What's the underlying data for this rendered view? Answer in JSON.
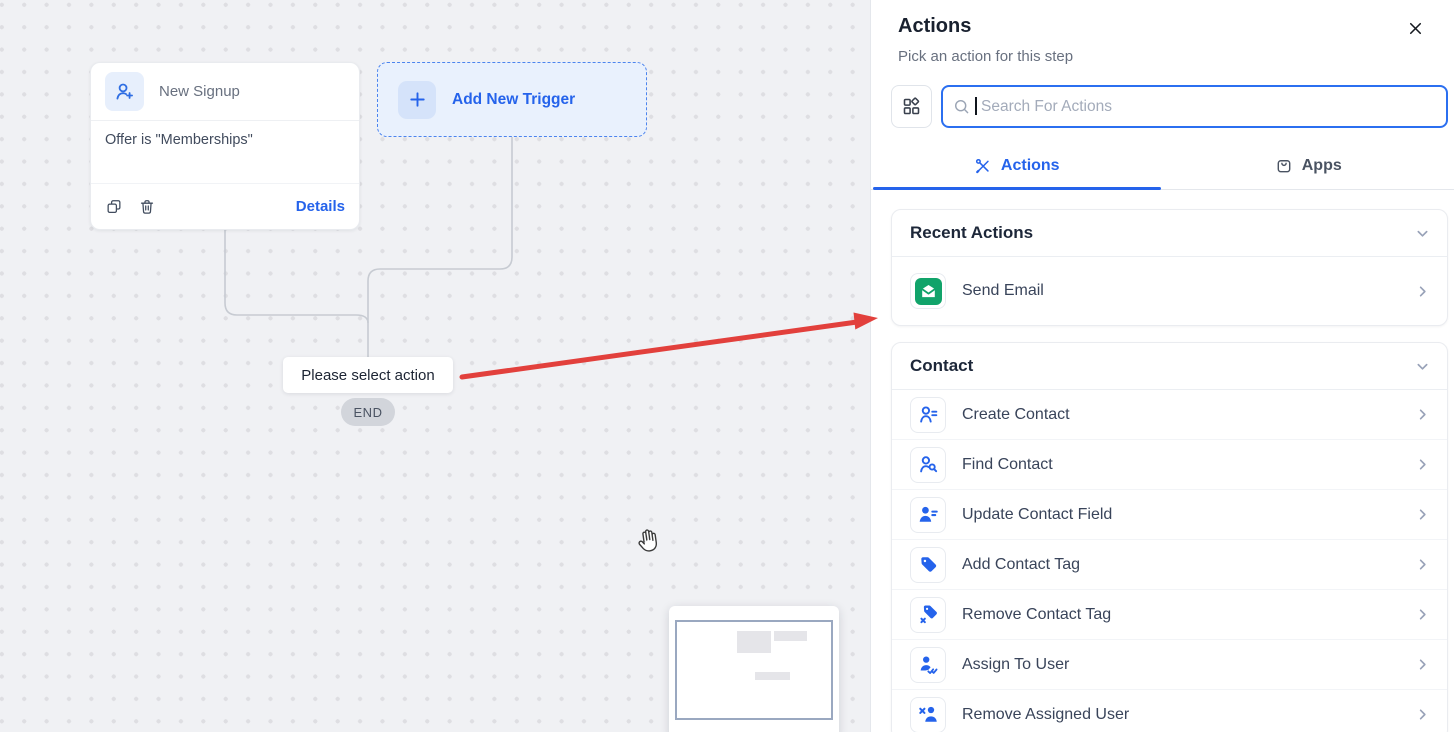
{
  "canvas": {
    "trigger_card": {
      "title": "New Signup",
      "filter": "Offer is \"Memberships\"",
      "details_label": "Details"
    },
    "add_trigger_label": "Add New Trigger",
    "select_action_label": "Please select action",
    "end_label": "END"
  },
  "panel": {
    "title": "Actions",
    "subtitle": "Pick an action for this step",
    "search": {
      "placeholder": "Search For Actions",
      "value": ""
    },
    "tabs": [
      {
        "label": "Actions",
        "icon": "tools-icon",
        "active": true
      },
      {
        "label": "Apps",
        "icon": "apps-bag-icon",
        "active": false
      }
    ],
    "sections": [
      {
        "title": "Recent Actions",
        "items": [
          {
            "label": "Send Email",
            "icon": "send-email"
          }
        ]
      },
      {
        "title": "Contact",
        "items": [
          {
            "label": "Create Contact",
            "icon": "create-contact"
          },
          {
            "label": "Find Contact",
            "icon": "find-contact"
          },
          {
            "label": "Update Contact Field",
            "icon": "update-contact-field"
          },
          {
            "label": "Add Contact Tag",
            "icon": "add-contact-tag"
          },
          {
            "label": "Remove Contact Tag",
            "icon": "remove-contact-tag"
          },
          {
            "label": "Assign To User",
            "icon": "assign-to-user"
          },
          {
            "label": "Remove Assigned User",
            "icon": "remove-assigned-user"
          }
        ]
      }
    ]
  },
  "colors": {
    "accent": "#2563eb",
    "arrow_red": "#e2403c",
    "email_green": "#11a36a",
    "canvas_bg": "#f0f1f4"
  }
}
